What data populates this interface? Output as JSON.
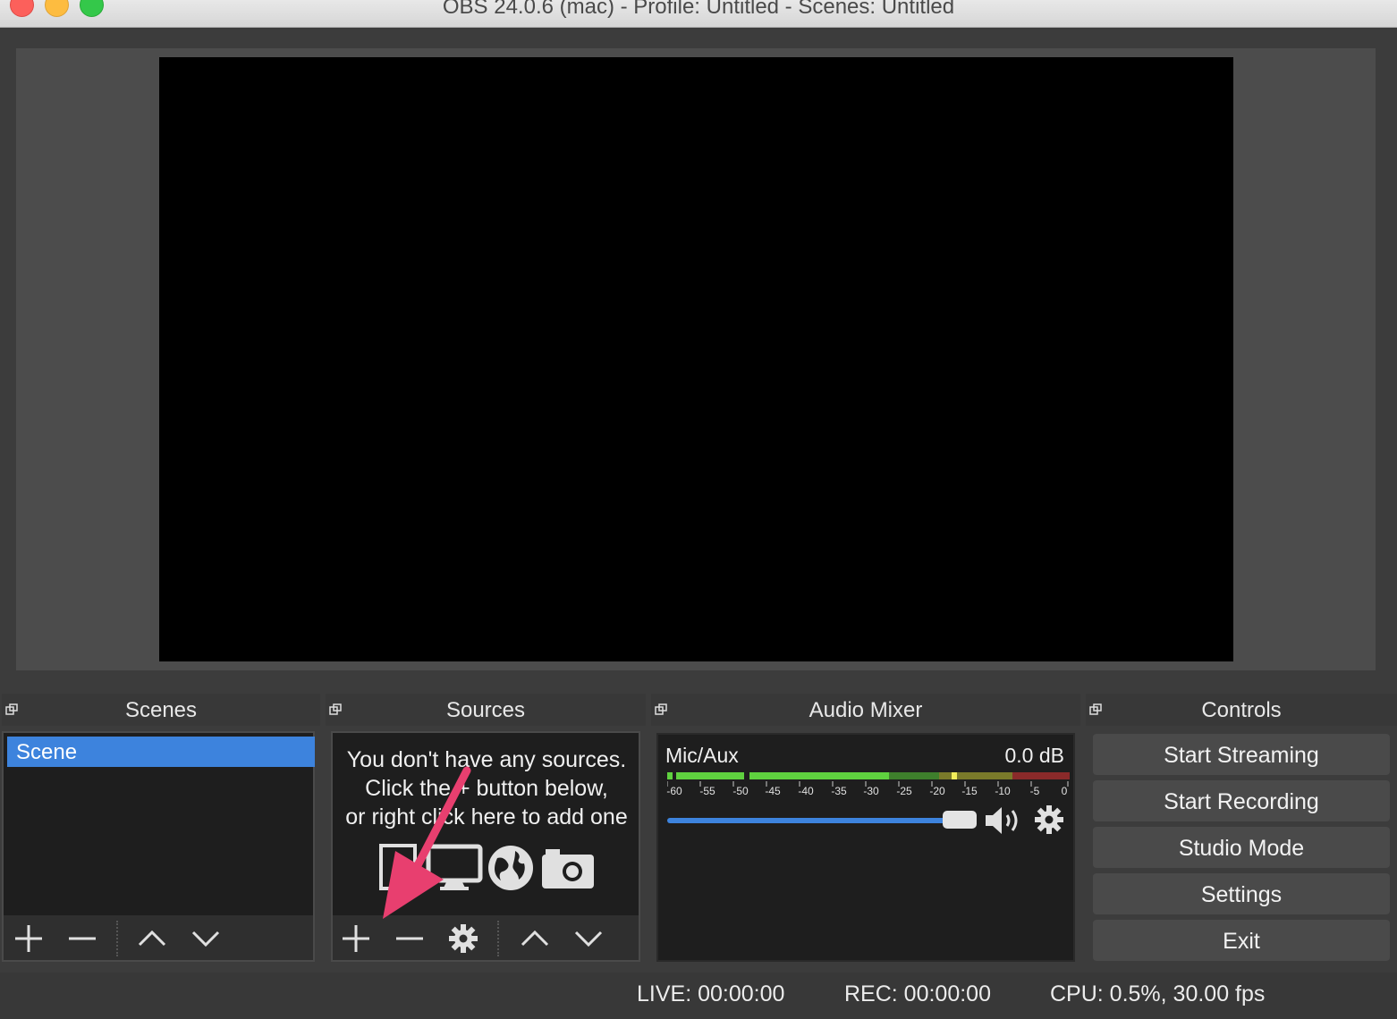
{
  "window": {
    "title": "OBS 24.0.6 (mac) - Profile: Untitled - Scenes: Untitled"
  },
  "docks": {
    "scenes": {
      "title": "Scenes",
      "items": [
        "Scene"
      ],
      "selected_index": 0
    },
    "sources": {
      "title": "Sources",
      "empty_hint": [
        "You don't have any sources.",
        "Click the + button below,",
        "or right click here to add one"
      ],
      "hint_icons": [
        "image-icon",
        "monitor-icon",
        "globe-icon",
        "camera-icon"
      ]
    },
    "audio_mixer": {
      "title": "Audio Mixer",
      "channels": [
        {
          "name": "Mic/Aux",
          "level": "0.0 dB",
          "ticks": [
            "-60",
            "-55",
            "-50",
            "-45",
            "-40",
            "-35",
            "-30",
            "-25",
            "-20",
            "-15",
            "-10",
            "-5",
            "0"
          ]
        }
      ]
    },
    "controls": {
      "title": "Controls",
      "buttons": [
        "Start Streaming",
        "Start Recording",
        "Studio Mode",
        "Settings",
        "Exit"
      ]
    }
  },
  "status": {
    "live": "LIVE: 00:00:00",
    "rec": "REC: 00:00:00",
    "cpu": "CPU: 0.5%, 30.00 fps"
  },
  "colors": {
    "accent": "#3d83dd",
    "annotation_arrow": "#e83f6f",
    "meter_green": "#5fd13f",
    "meter_yellow": "#d6d03a",
    "meter_red": "#c23b3b"
  }
}
